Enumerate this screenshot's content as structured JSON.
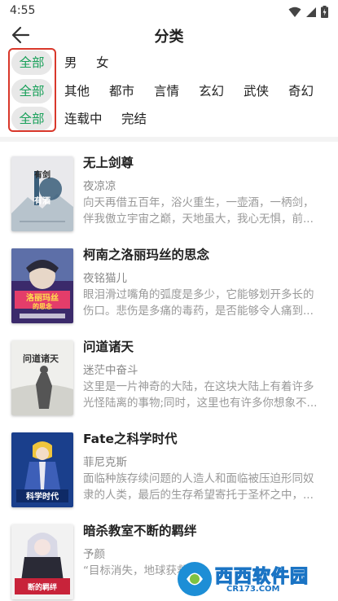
{
  "status_bar": {
    "time": "4:55",
    "icons": [
      "wifi-icon",
      "signal-icon",
      "battery-icon"
    ]
  },
  "header": {
    "title": "分类",
    "back_icon": "arrow-left-icon"
  },
  "filters": {
    "accent_color": "#1aa05a",
    "highlight_color": "#d9382b",
    "rows": [
      {
        "selected": "全部",
        "options": [
          "男",
          "女"
        ]
      },
      {
        "selected": "全部",
        "options": [
          "其他",
          "都市",
          "言情",
          "玄幻",
          "武侠",
          "奇幻"
        ]
      },
      {
        "selected": "全部",
        "options": [
          "连载中",
          "完结"
        ]
      }
    ]
  },
  "books": [
    {
      "title": "无上剑尊",
      "author": "夜凉凉",
      "desc": "向天再借五百年，浴火重生，一壶酒，一柄剑，伴我傲立宇宙之巅，天地虽大，我心无惧，前..."
    },
    {
      "title": "柯南之洛丽玛丝的思念",
      "author": "夜铭猫儿",
      "desc": "眼泪滑过嘴角的弧度是多少，它能够划开多长的伤口。悲伤是多痛的毒药，是否能够令人痛到..."
    },
    {
      "title": "问道诸天",
      "author": "迷茫中奋斗",
      "desc": "这里是一片神奇的大陆，在这块大陆上有着许多光怪陆离的事物;同时，这里也有许多你想象不..."
    },
    {
      "title": "Fate之科学时代",
      "author": "菲尼克斯",
      "desc": "面临种族存续问题的人造人和面临被压迫形同奴隶的人类，最后的生存希望寄托于圣杯之中，..."
    },
    {
      "title": "暗杀教室不断的羁绊",
      "author": "予颜",
      "desc": "“目标消失，地球获救…"
    }
  ],
  "covers": [
    {
      "text": "有剑有酒",
      "colors": [
        "#e9e9ec",
        "#3a5e7a"
      ]
    },
    {
      "text": "洛丽玛丝的思念",
      "colors": [
        "#3b2a6b",
        "#e43d6a"
      ]
    },
    {
      "text": "问道诸天",
      "colors": [
        "#efefec",
        "#555555"
      ]
    },
    {
      "text": "科学时代",
      "colors": [
        "#1a3f8c",
        "#f0c53c"
      ]
    },
    {
      "text": "暗杀教室不断的羁绊",
      "colors": [
        "#f2f2f2",
        "#c8233a"
      ]
    }
  ],
  "watermark": {
    "text": "西西软件园",
    "url": "CR173.COM"
  }
}
